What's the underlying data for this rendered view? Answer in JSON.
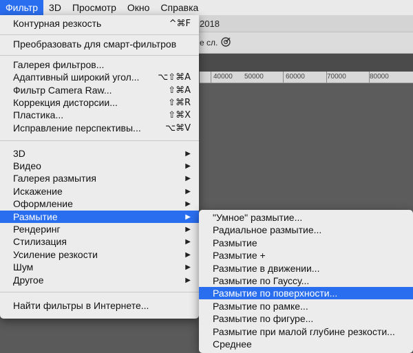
{
  "menubar": {
    "items": [
      "Фильтр",
      "3D",
      "Просмотр",
      "Окно",
      "Справка"
    ],
    "active_index": 0
  },
  "background": {
    "title_fragment": "2018",
    "options_label": "е сл.",
    "options_icon": "target-icon",
    "ruler_labels": [
      "40000",
      "50000",
      "60000",
      "70000",
      "80000"
    ]
  },
  "main_menu": {
    "items": [
      {
        "label": "Контурная резкость",
        "shortcut": "^⌘F"
      },
      {
        "label": "Преобразовать для смарт-фильтров",
        "shortcut": ""
      },
      {
        "label": "Галерея фильтров...",
        "shortcut": ""
      },
      {
        "label": "Адаптивный широкий угол...",
        "shortcut": "⌥⇧⌘A"
      },
      {
        "label": "Фильтр Camera Raw...",
        "shortcut": "⇧⌘A"
      },
      {
        "label": "Коррекция дисторсии...",
        "shortcut": "⇧⌘R"
      },
      {
        "label": "Пластика...",
        "shortcut": "⇧⌘X"
      },
      {
        "label": "Исправление перспективы...",
        "shortcut": "⌥⌘V"
      },
      {
        "label": "3D",
        "shortcut": ""
      },
      {
        "label": "Видео",
        "shortcut": ""
      },
      {
        "label": "Галерея размытия",
        "shortcut": ""
      },
      {
        "label": "Искажение",
        "shortcut": ""
      },
      {
        "label": "Оформление",
        "shortcut": ""
      },
      {
        "label": "Размытие",
        "shortcut": ""
      },
      {
        "label": "Рендеринг",
        "shortcut": ""
      },
      {
        "label": "Стилизация",
        "shortcut": ""
      },
      {
        "label": "Усиление резкости",
        "shortcut": ""
      },
      {
        "label": "Шум",
        "shortcut": ""
      },
      {
        "label": "Другое",
        "shortcut": ""
      },
      {
        "label": "Найти фильтры в Интернете...",
        "shortcut": ""
      }
    ],
    "highlighted": "Размытие"
  },
  "sub_menu": {
    "items": [
      "\"Умное\" размытие...",
      "Радиальное размытие...",
      "Размытие",
      "Размытие +",
      "Размытие в движении...",
      "Размытие по Гауссу...",
      "Размытие по поверхности...",
      "Размытие по рамке...",
      "Размытие по фигуре...",
      "Размытие при малой глубине резкости...",
      "Среднее"
    ],
    "highlighted": "Размытие по поверхности..."
  },
  "colors": {
    "accent": "#2a6ef0",
    "menu_bg": "#ececec",
    "canvas_bg": "#5c5c5c"
  }
}
